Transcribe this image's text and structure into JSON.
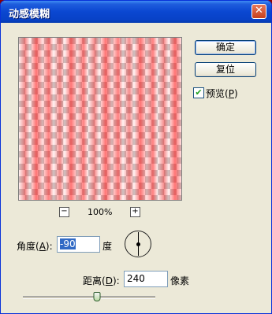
{
  "window": {
    "title": "动感模糊",
    "close_symbol": "✕"
  },
  "buttons": {
    "ok": "确定",
    "reset": "复位"
  },
  "preview_option": {
    "label_prefix": "预览(",
    "hotkey": "P",
    "label_suffix": ")",
    "checked": true,
    "check_symbol": "✔"
  },
  "zoom": {
    "minus": "−",
    "plus": "+",
    "value": "100%"
  },
  "angle": {
    "label_prefix": "角度(",
    "hotkey": "A",
    "label_suffix": "):",
    "value": "-90",
    "unit": "度"
  },
  "distance": {
    "label_prefix": "距离(",
    "hotkey": "D",
    "label_suffix": "):",
    "value": "240",
    "unit": "像素",
    "slider_fraction": 0.56
  },
  "colors": {
    "title_bar": "#0a47d1",
    "dialog_bg": "#ece9d8",
    "blur_red": "#ff0000"
  }
}
